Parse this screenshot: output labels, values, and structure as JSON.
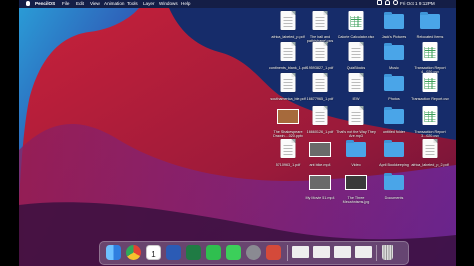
{
  "menubar": {
    "app_name": "PencilOS",
    "items": [
      "File",
      "Edit",
      "View",
      "Animation",
      "Tools",
      "Layer",
      "Windows",
      "Help"
    ],
    "clock": "Fri Oct 1  9:12PM"
  },
  "desktop": {
    "items": [
      {
        "label": "africa_labeled_p.pdf",
        "kind": "doc"
      },
      {
        "label": "The ball and path(shape).pcs",
        "kind": "doc"
      },
      {
        "label": "Calorie Calculator.xlsx",
        "kind": "sheet"
      },
      {
        "label": "Jack's Pictures",
        "kind": "folder"
      },
      {
        "label": "Relocated Items",
        "kind": "folder"
      },
      {
        "label": "continents_blank_1.pdf",
        "kind": "doc"
      },
      {
        "label": "19593827_1.pdf",
        "kind": "doc"
      },
      {
        "label": "QuizBlocks",
        "kind": "doc"
      },
      {
        "label": "Music",
        "kind": "folder"
      },
      {
        "label": "Transaction Report 4...020.csv",
        "kind": "sheet"
      },
      {
        "label": "southamerica_ble.pdf",
        "kind": "doc"
      },
      {
        "label": "16677965_1.pdf",
        "kind": "doc"
      },
      {
        "label": "IEW",
        "kind": "doc"
      },
      {
        "label": "Photos",
        "kind": "folder"
      },
      {
        "label": "Transaction Report.csv",
        "kind": "sheet"
      },
      {
        "label": "The Shakespeare Drawin....020.pptx",
        "kind": "thumb"
      },
      {
        "label": "16660126_1.pdf",
        "kind": "doc"
      },
      {
        "label": "That's not the Way They Are.mp3",
        "kind": "doc"
      },
      {
        "label": "untitled folder",
        "kind": "folder"
      },
      {
        "label": "Transaction Report 3...020.csv",
        "kind": "sheet"
      },
      {
        "label": "5710963_1.pdf",
        "kind": "doc"
      },
      {
        "label": "ant bike.mp4",
        "kind": "thumb"
      },
      {
        "label": "Video",
        "kind": "folder"
      },
      {
        "label": "April Bookkeeping",
        "kind": "folder"
      },
      {
        "label": "africa_labeled_p_2.pdf",
        "kind": "doc"
      },
      {
        "label": "My Movie 51.mp4",
        "kind": "thumb"
      },
      {
        "label": "The Three Mecahnisms.jpg",
        "kind": "thumb"
      },
      {
        "label": "Documents",
        "kind": "folder"
      }
    ]
  },
  "dock": {
    "apps": [
      {
        "name": "Finder",
        "color": "#3d8fe8"
      },
      {
        "name": "Chrome",
        "color": "#ffffff"
      },
      {
        "name": "Calendar",
        "color": "#ffffff",
        "text": "1"
      },
      {
        "name": "Word",
        "color": "#2b5bb5"
      },
      {
        "name": "Excel",
        "color": "#1f7b44"
      },
      {
        "name": "FaceTime",
        "color": "#2fbf4f"
      },
      {
        "name": "Messages",
        "color": "#3ccf5a"
      },
      {
        "name": "System Preferences",
        "color": "#8a8a92"
      },
      {
        "name": "PencilOS",
        "color": "#d44a3a"
      }
    ],
    "recents": [
      "Document 1",
      "Document 2",
      "Document 3",
      "Document 4"
    ],
    "trash_name": "Trash"
  }
}
